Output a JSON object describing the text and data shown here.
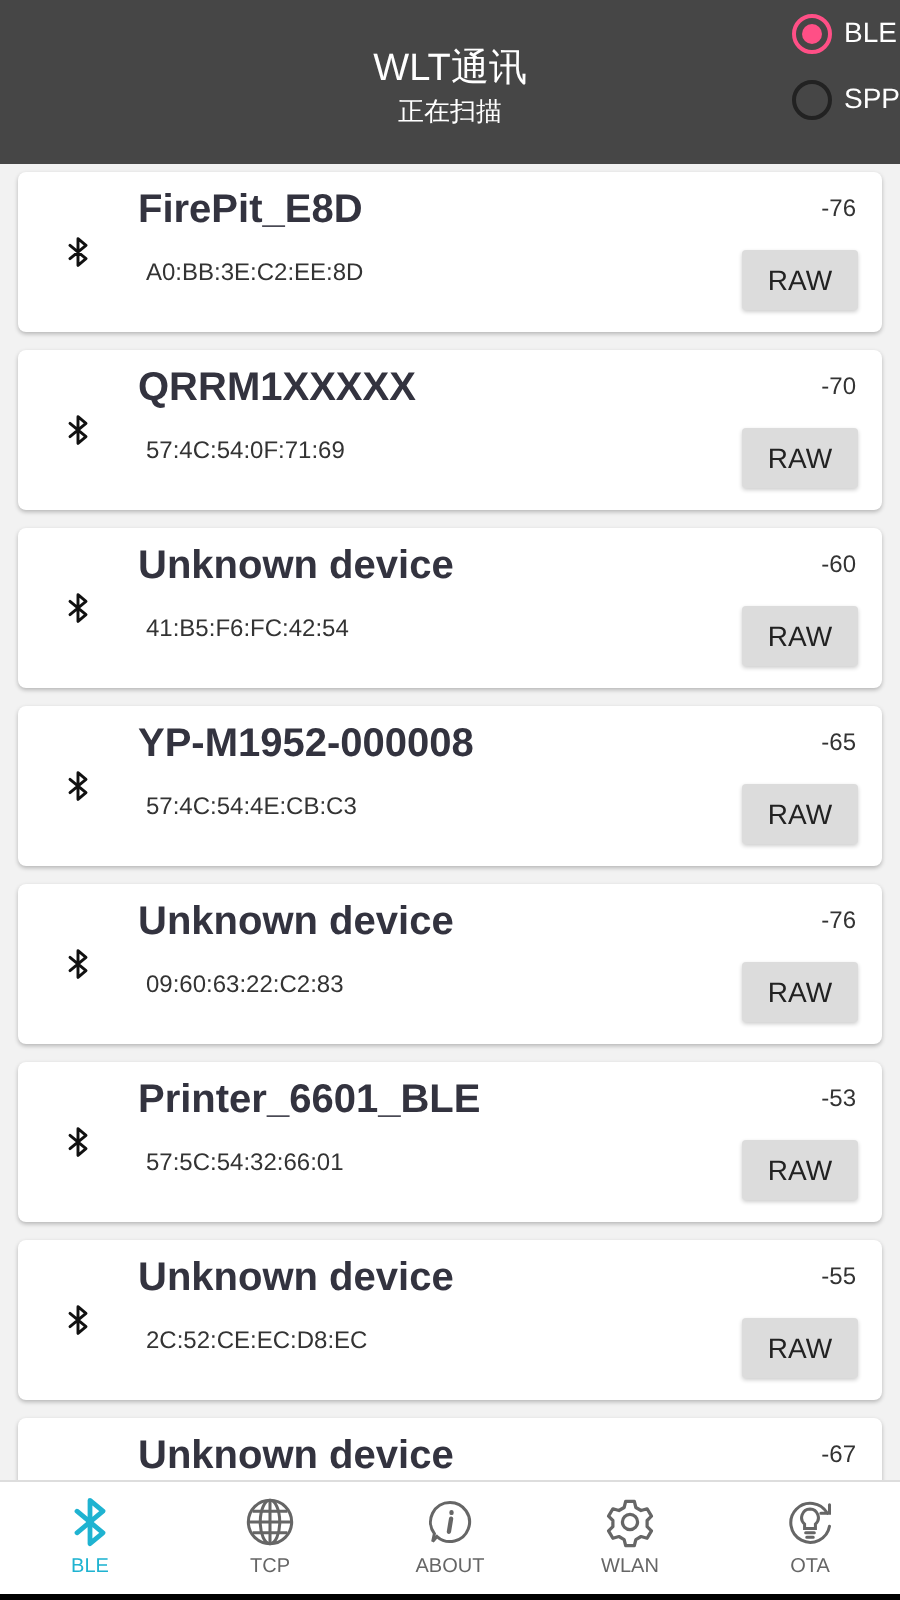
{
  "header": {
    "title": "WLT通讯",
    "subtitle": "正在扫描"
  },
  "modes": [
    {
      "label": "BLE",
      "selected": true
    },
    {
      "label": "SPP",
      "selected": false
    }
  ],
  "devices": [
    {
      "name": "FirePit_E8D",
      "address": "A0:BB:3E:C2:EE:8D",
      "rssi": "-76",
      "button": "RAW"
    },
    {
      "name": "QRRM1XXXXX",
      "address": "57:4C:54:0F:71:69",
      "rssi": "-70",
      "button": "RAW"
    },
    {
      "name": "Unknown device",
      "address": "41:B5:F6:FC:42:54",
      "rssi": "-60",
      "button": "RAW"
    },
    {
      "name": "YP-M1952-000008",
      "address": "57:4C:54:4E:CB:C3",
      "rssi": "-65",
      "button": "RAW"
    },
    {
      "name": "Unknown device",
      "address": "09:60:63:22:C2:83",
      "rssi": "-76",
      "button": "RAW"
    },
    {
      "name": "Printer_6601_BLE",
      "address": "57:5C:54:32:66:01",
      "rssi": "-53",
      "button": "RAW"
    },
    {
      "name": "Unknown device",
      "address": "2C:52:CE:EC:D8:EC",
      "rssi": "-55",
      "button": "RAW"
    },
    {
      "name": "Unknown device",
      "rssi": "-67"
    }
  ],
  "nav": [
    {
      "kind": "bluetooth",
      "label": "BLE",
      "selected": true
    },
    {
      "kind": "globe",
      "label": "TCP",
      "selected": false
    },
    {
      "kind": "info",
      "label": "ABOUT",
      "selected": false
    },
    {
      "kind": "gear",
      "label": "WLAN",
      "selected": false
    },
    {
      "kind": "bulb",
      "label": "OTA",
      "selected": false
    }
  ]
}
